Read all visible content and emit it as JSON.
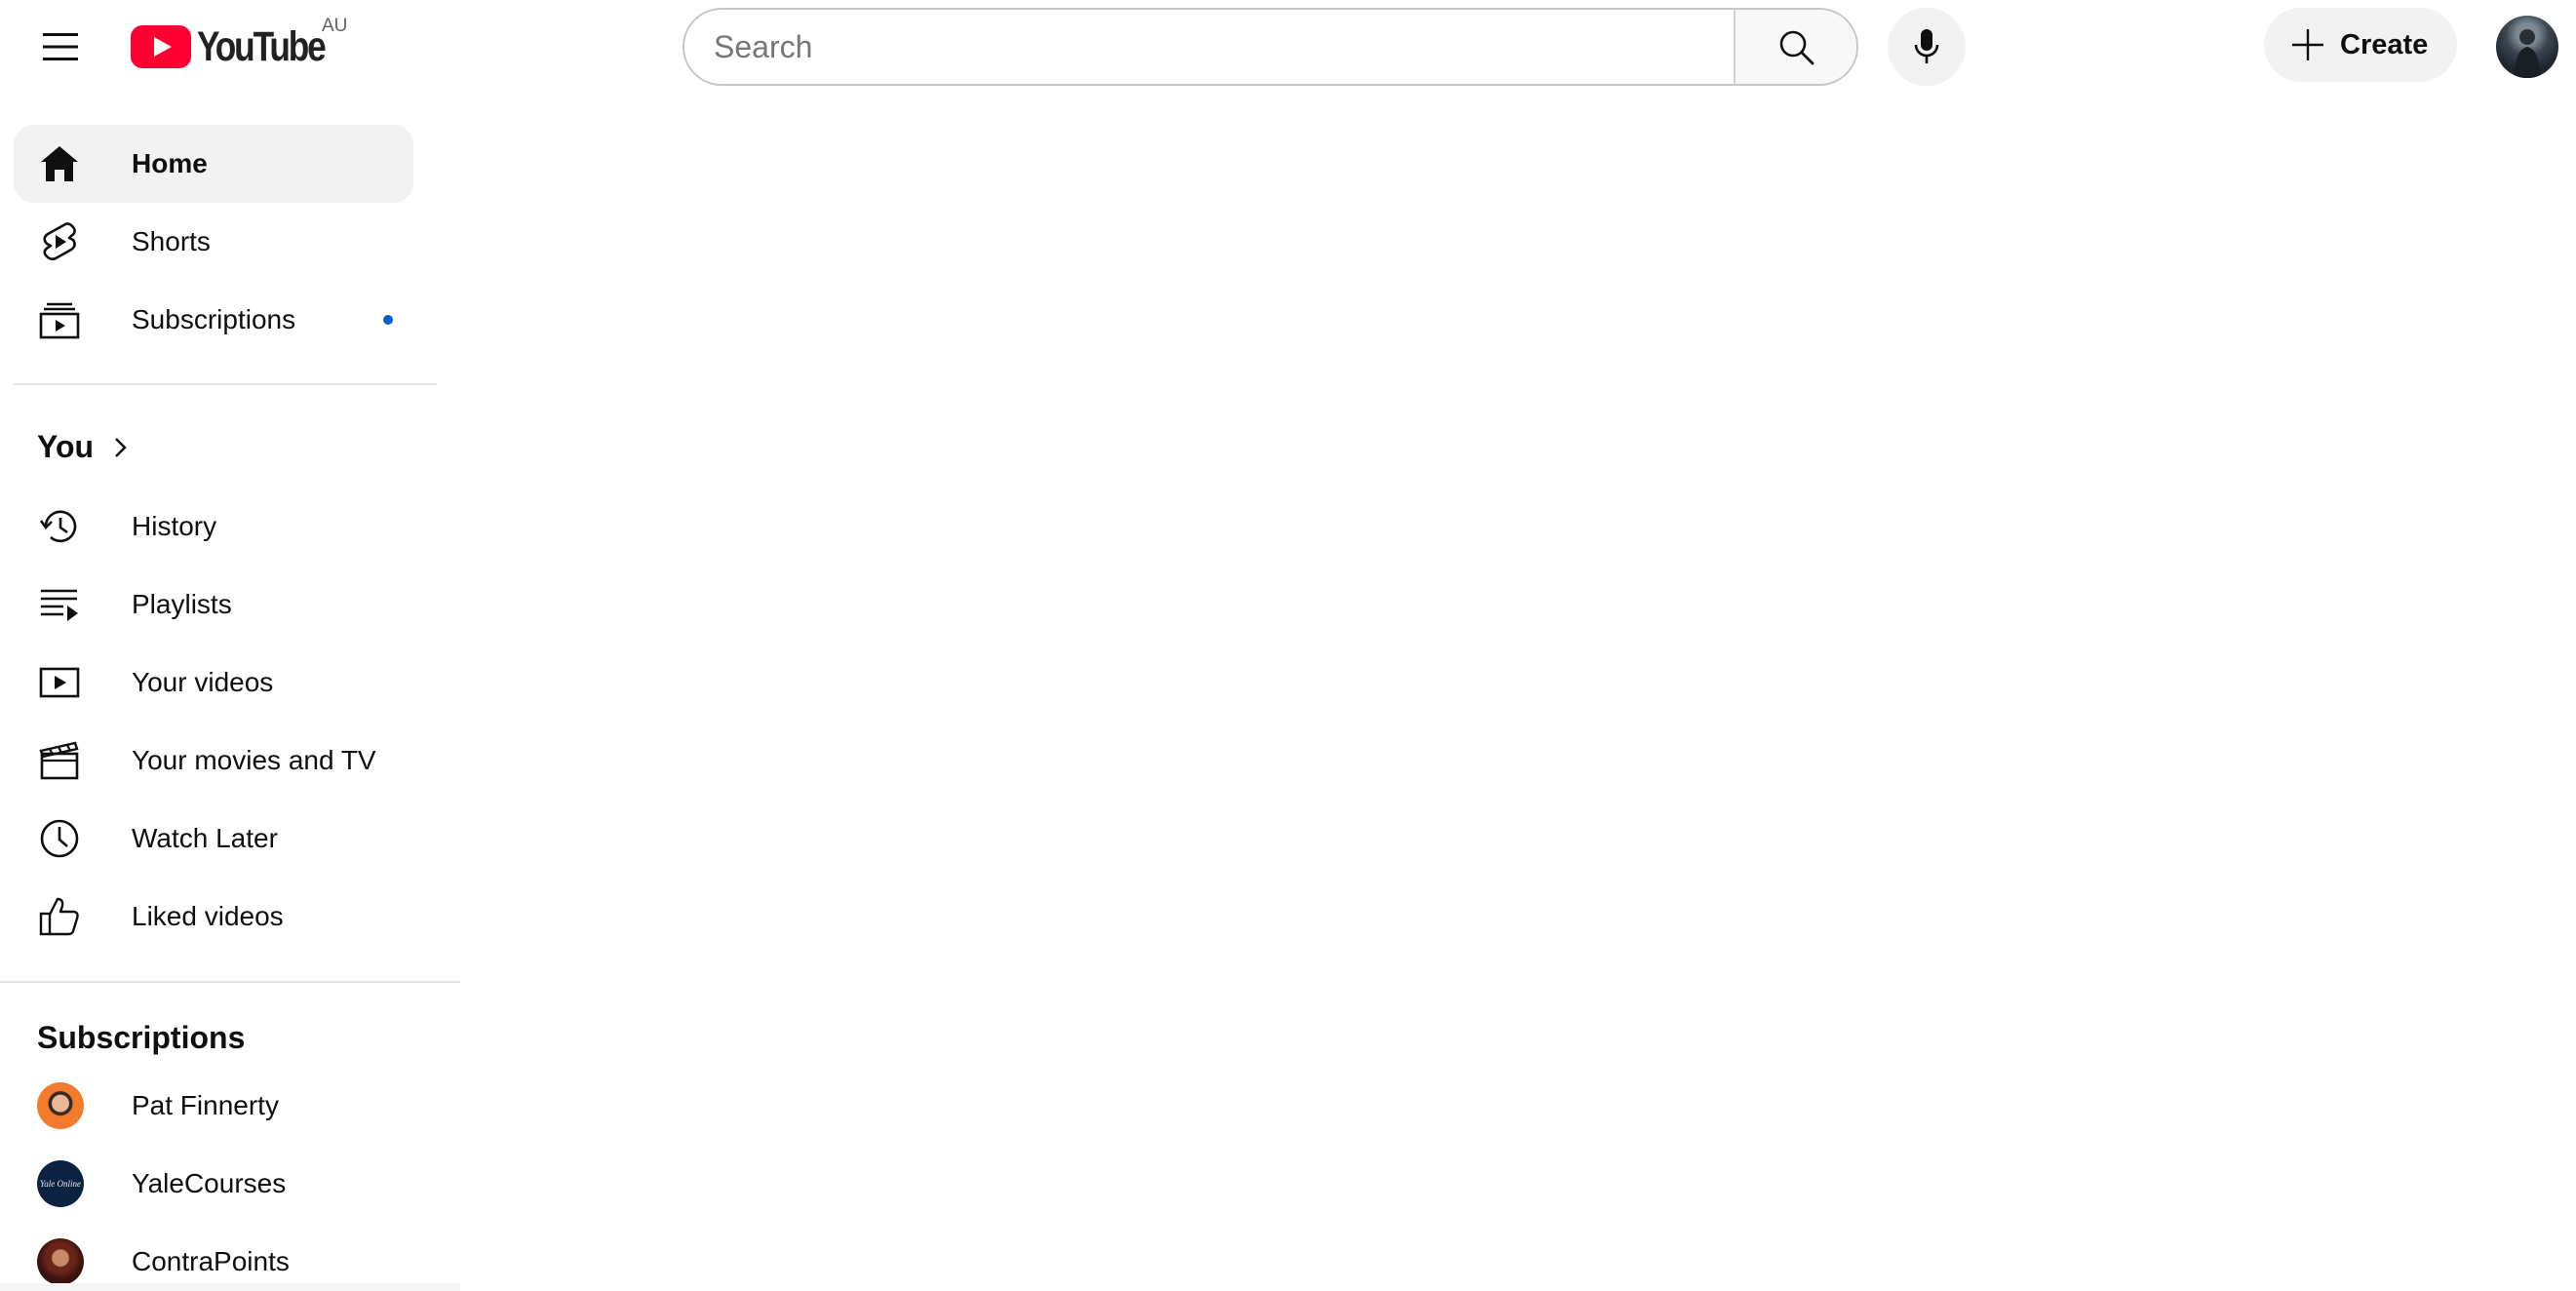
{
  "header": {
    "brand": "YouTube",
    "country_code": "AU",
    "search_placeholder": "Search",
    "create_label": "Create"
  },
  "sidebar": {
    "main_items": [
      {
        "label": "Home",
        "icon": "home-icon",
        "active": true
      },
      {
        "label": "Shorts",
        "icon": "shorts-icon"
      },
      {
        "label": "Subscriptions",
        "icon": "subscriptions-icon",
        "has_new_dot": true
      }
    ],
    "you_section": {
      "title": "You",
      "items": [
        {
          "label": "History",
          "icon": "history-icon"
        },
        {
          "label": "Playlists",
          "icon": "playlists-icon"
        },
        {
          "label": "Your videos",
          "icon": "your-videos-icon"
        },
        {
          "label": "Your movies and TV",
          "icon": "movies-icon"
        },
        {
          "label": "Watch Later",
          "icon": "clock-icon"
        },
        {
          "label": "Liked videos",
          "icon": "thumbs-up-icon"
        }
      ]
    },
    "subscriptions_section": {
      "title": "Subscriptions",
      "channels": [
        {
          "label": "Pat Finnerty"
        },
        {
          "label": "YaleCourses",
          "avatar_text": "Yale Online"
        },
        {
          "label": "ContraPoints"
        }
      ]
    }
  },
  "colors": {
    "brand_red": "#ff0033",
    "active_bg": "#f2f2f2",
    "dot_blue": "#065fd4"
  }
}
